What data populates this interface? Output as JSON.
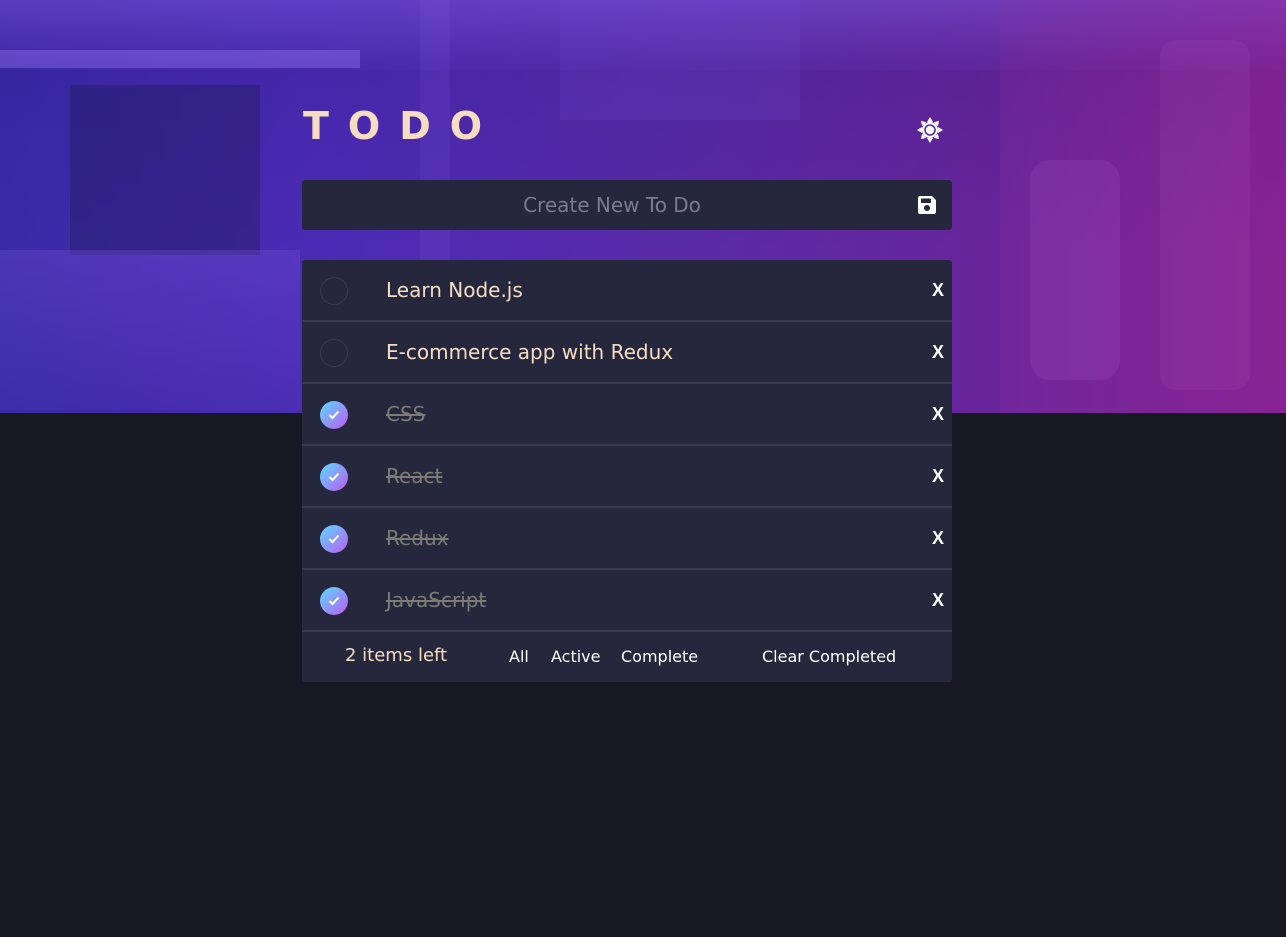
{
  "app": {
    "title": "TODO"
  },
  "theme_toggle": {
    "icon": "sun-icon"
  },
  "new_todo": {
    "placeholder": "Create New To Do",
    "value": "",
    "save_icon": "save-icon"
  },
  "todos": [
    {
      "text": "Learn Node.js",
      "completed": false,
      "delete_label": "X"
    },
    {
      "text": "E-commerce app with Redux",
      "completed": false,
      "delete_label": "X"
    },
    {
      "text": "CSS",
      "completed": true,
      "delete_label": "X"
    },
    {
      "text": "React",
      "completed": true,
      "delete_label": "X"
    },
    {
      "text": "Redux",
      "completed": true,
      "delete_label": "X"
    },
    {
      "text": "JavaScript",
      "completed": true,
      "delete_label": "X"
    }
  ],
  "footer": {
    "items_left": "2 items left",
    "filters": [
      "All",
      "Active",
      "Complete"
    ],
    "clear_completed": "Clear Completed"
  },
  "colors": {
    "background": "#181824",
    "panel": "#25273c",
    "text": "#f6dcc0",
    "completed_text": "#7e7b74",
    "check_gradient_start": "#57ddff",
    "check_gradient_end": "#c058f3"
  }
}
